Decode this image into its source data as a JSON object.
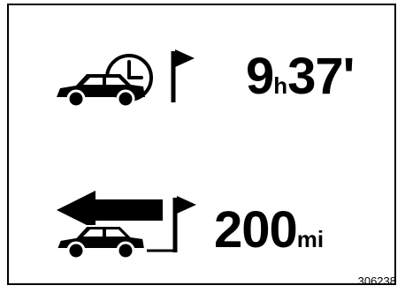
{
  "display": {
    "remaining_time": {
      "icon": "car-clock-flag-icon",
      "hours": "9",
      "hours_unit": "h",
      "minutes": "37",
      "minutes_unit": "'"
    },
    "remaining_distance": {
      "icon": "car-arrow-flag-icon",
      "value": "200",
      "unit": "mi"
    }
  },
  "figure_code": "306238",
  "colors": {
    "foreground": "#000000",
    "background": "#ffffff"
  }
}
